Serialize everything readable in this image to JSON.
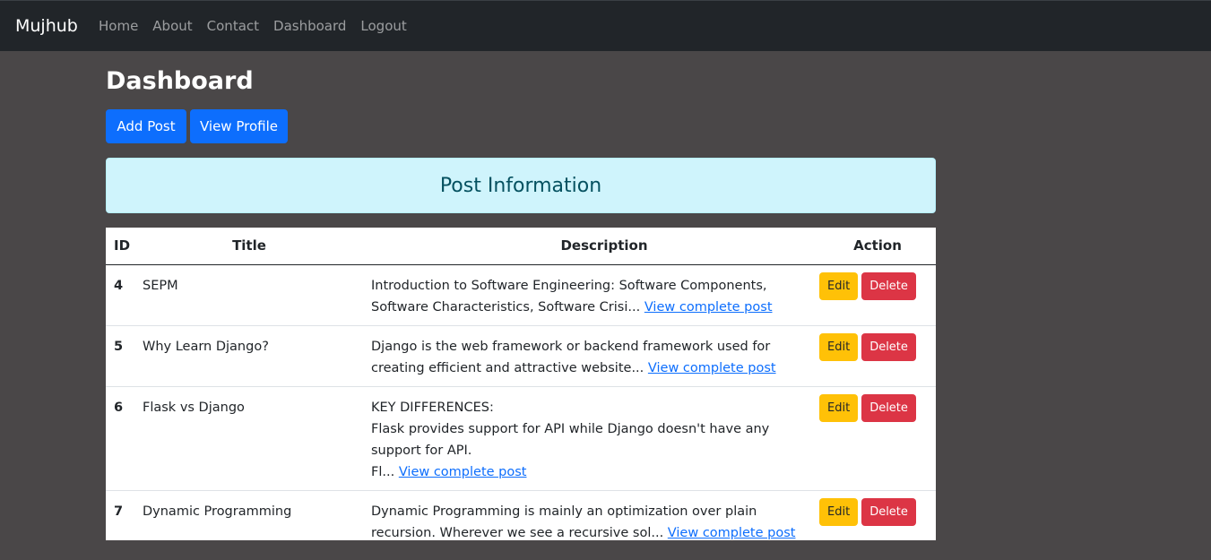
{
  "navbar": {
    "brand": "Mujhub",
    "links": [
      "Home",
      "About",
      "Contact",
      "Dashboard",
      "Logout"
    ]
  },
  "page": {
    "title": "Dashboard",
    "add_post_label": "Add Post",
    "view_profile_label": "View Profile"
  },
  "alert": {
    "title": "Post Information"
  },
  "table": {
    "headers": {
      "id": "ID",
      "title": "Title",
      "description": "Description",
      "action": "Action"
    },
    "rows": [
      {
        "id": "4",
        "title": "SEPM",
        "description": "Introduction to Software Engineering: Software Components, Software Characteristics, Software Crisi...",
        "link": "View complete post",
        "edit": "Edit",
        "delete": "Delete"
      },
      {
        "id": "5",
        "title": "Why Learn Django?",
        "description": "Django is the web framework or backend framework used for creating efficient and attractive website...",
        "link": "View complete post",
        "edit": "Edit",
        "delete": "Delete"
      },
      {
        "id": "6",
        "title": "Flask vs Django",
        "description": "KEY DIFFERENCES:\nFlask provides support for API while Django doesn't have any support for API.\nFl...",
        "link": "View complete post",
        "edit": "Edit",
        "delete": "Delete"
      },
      {
        "id": "7",
        "title": "Dynamic Programming",
        "description": "Dynamic Programming is mainly an optimization over plain recursion. Wherever we see a recursive sol...",
        "link": "View complete post",
        "edit": "Edit",
        "delete": "Delete"
      }
    ]
  },
  "colors": {
    "navbar_bg": "#212529",
    "page_bg": "#4a4748",
    "primary": "#0d6efd",
    "info_bg": "#cff4fc",
    "warning": "#ffc107",
    "danger": "#dc3545"
  }
}
